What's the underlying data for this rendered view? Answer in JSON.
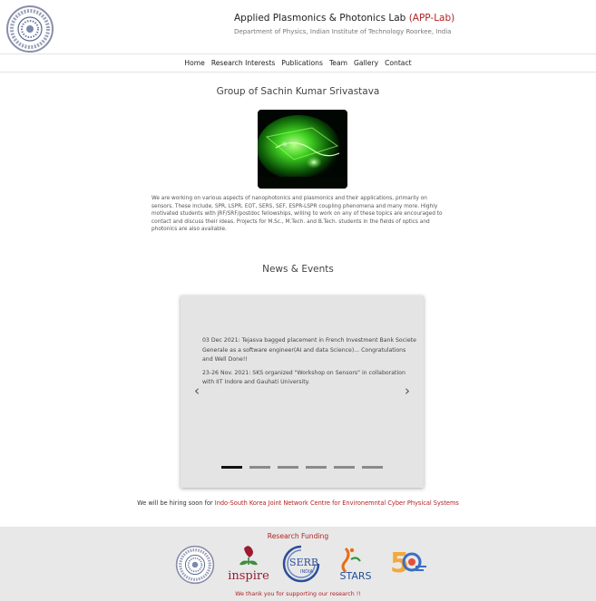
{
  "header": {
    "title_main": "Applied Plasmonics & Photonics Lab ",
    "title_accent": "(APP-Lab)",
    "subtitle": "Department of Physics, Indian Institute of Technology Roorkee, India",
    "logo_icon": "iit-roorkee-logo",
    "accent_color": "#b22222"
  },
  "nav": {
    "items": [
      "Home",
      "Research Interests",
      "Publications",
      "Team",
      "Gallery",
      "Contact"
    ]
  },
  "group": {
    "title": "Group of Sachin Kumar Srivastava",
    "photo_icon": "green-laser-setup-photo",
    "intro": "We are working on various aspects of nanophotonics and plasmonics and their applications, primarily on sensors. These include, SPR, LSPR, EOT, SERS, SEF, ESPR-LSPR coupling phenomena and many more. Highly motivated students with JRF/SRF/postdoc fellowships, willing to work on any of these topics are encouraged to contact and discuss their ideas. Projects for M.Sc., M.Tech. and B.Tech. students in the fields of optics and photonics are also available."
  },
  "news": {
    "title": "News & Events",
    "items": [
      "03 Dec 2021: Tejasva bagged placement in French Investment Bank Societe Generale as a software engineer(AI and data Science)... Congratulations and Well Done!!",
      "23-26 Nov. 2021: SKS organized \"Workshop on Sensors\" in collaboration with IIT Indore and Gauhati University."
    ],
    "prev_arrow": "‹",
    "next_arrow": "›",
    "indicator_count": 6,
    "active_indicator": 0
  },
  "hiring": {
    "text": "We will be hiring soon for ",
    "link": "Indo-South Korea Joint Network Centre for Environemntal Cyber Physical Systems"
  },
  "footer": {
    "funding_title": "Research Funding",
    "logos": [
      "iit-roorkee-logo",
      "inspire-logo",
      "serb-logo",
      "stars-logo",
      "isro-50-logo"
    ],
    "thanks": "We thank you for supporting our research !!"
  }
}
